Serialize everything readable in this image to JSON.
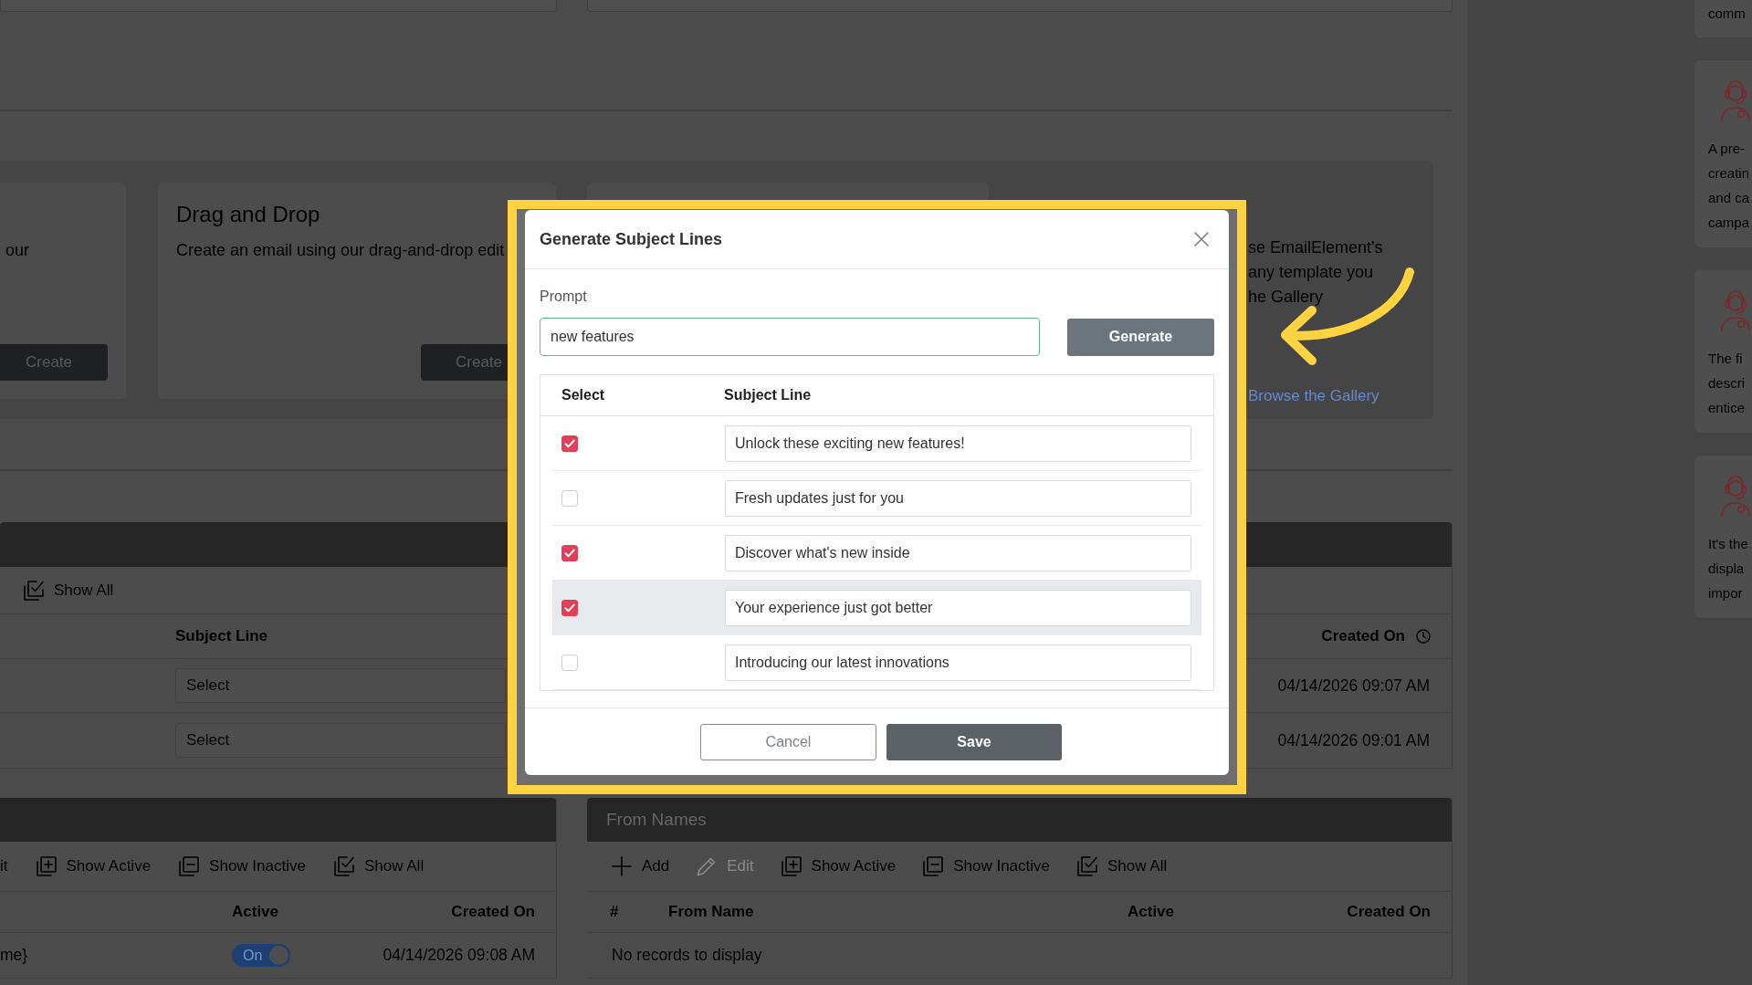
{
  "templates": {
    "cards": [
      {
        "description": "our",
        "button": "Create"
      },
      {
        "title": "Drag and Drop",
        "description": "Create an email using our drag-and-drop edit",
        "button": "Create"
      },
      {
        "description_lines": [
          "se EmailElement's",
          "any template you",
          "he Gallery"
        ],
        "link": "Browse the Gallery"
      }
    ]
  },
  "subject_lines_panel": {
    "toolbar": [
      {
        "kind": "show_all",
        "label": "Show All",
        "disabled": false
      }
    ],
    "columns": [
      {
        "label": "Subject Line",
        "sorted": false
      },
      {
        "label": "Created On",
        "sorted": true
      }
    ],
    "rows": [
      {
        "placeholder": "Select",
        "created_on": "04/14/2026 09:07 AM"
      },
      {
        "placeholder": "Select",
        "created_on": "04/14/2026 09:01 AM"
      }
    ]
  },
  "bottom_left_panel": {
    "toolbar": [
      {
        "kind": "text",
        "label": "it",
        "disabled": false
      },
      {
        "kind": "show_active",
        "label": "Show Active",
        "disabled": false
      },
      {
        "kind": "show_inactive",
        "label": "Show Inactive",
        "disabled": false
      },
      {
        "kind": "show_all",
        "label": "Show All",
        "disabled": false
      }
    ],
    "columns": [
      {
        "label": "Active"
      },
      {
        "label": "Created On"
      }
    ],
    "rows": [
      {
        "name": "me}",
        "active": true,
        "toggle_label": "On",
        "created_on": "04/14/2026 09:08 AM"
      }
    ]
  },
  "from_names_panel": {
    "title": "From Names",
    "toolbar": [
      {
        "kind": "add",
        "label": "Add",
        "disabled": false
      },
      {
        "kind": "edit",
        "label": "Edit",
        "disabled": true
      },
      {
        "kind": "show_active",
        "label": "Show Active",
        "disabled": false
      },
      {
        "kind": "show_inactive",
        "label": "Show Inactive",
        "disabled": false
      },
      {
        "kind": "show_all",
        "label": "Show All",
        "disabled": false
      }
    ],
    "columns": [
      {
        "label": "#"
      },
      {
        "label": "From Name"
      },
      {
        "label": "Active"
      },
      {
        "label": "Created On"
      }
    ],
    "empty_message": "No records to display"
  },
  "help_cards": [
    {
      "kind": "plain",
      "lines": [
        "comm"
      ]
    },
    {
      "kind": "illustrated",
      "lines": [
        "A pre-",
        "creatin",
        "and ca",
        "campa"
      ]
    },
    {
      "kind": "illustrated",
      "lines": [
        "The fi",
        "descri",
        "entice"
      ]
    },
    {
      "kind": "illustrated",
      "lines": [
        "It's the",
        "displa",
        "impor"
      ]
    }
  ],
  "modal": {
    "title": "Generate Subject Lines",
    "prompt_label": "Prompt",
    "prompt_value": "new features",
    "generate_button": "Generate",
    "columns": [
      "Select",
      "Subject Line"
    ],
    "rows": [
      {
        "checked": true,
        "hovered": false,
        "subject": "Unlock these exciting new features!"
      },
      {
        "checked": false,
        "hovered": false,
        "subject": "Fresh updates just for you"
      },
      {
        "checked": true,
        "hovered": false,
        "subject": "Discover what's new inside"
      },
      {
        "checked": true,
        "hovered": true,
        "subject": "Your experience just got better"
      },
      {
        "checked": false,
        "hovered": false,
        "subject": "Introducing our latest innovations"
      }
    ],
    "buttons": [
      {
        "kind": "secondary",
        "label": "Cancel"
      },
      {
        "kind": "primary",
        "label": "Save"
      }
    ]
  }
}
